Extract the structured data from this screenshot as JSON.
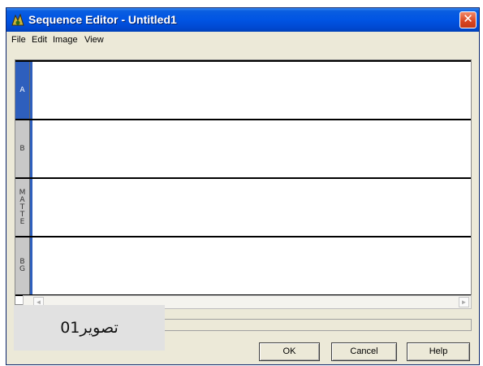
{
  "window": {
    "title": "Sequence Editor - Untitled1",
    "close_glyph": "✕"
  },
  "menu": [
    "File",
    "Edit",
    "Image",
    "View"
  ],
  "tracks": [
    {
      "label": "A",
      "active": true
    },
    {
      "label": "B",
      "active": false
    },
    {
      "label": "M\nA\nT\nT\nE",
      "active": false
    },
    {
      "label": "B\nG",
      "active": false
    }
  ],
  "scrollbar": {
    "left_arrow": "◄",
    "right_arrow": "►"
  },
  "buttons": {
    "ok": "OK",
    "cancel": "Cancel",
    "help": "Help"
  },
  "watermark": {
    "text": "تصویر01"
  },
  "colors": {
    "titlebar": "#0054e3",
    "close_button": "#d9441f",
    "active_track": "#2e5fbd"
  }
}
